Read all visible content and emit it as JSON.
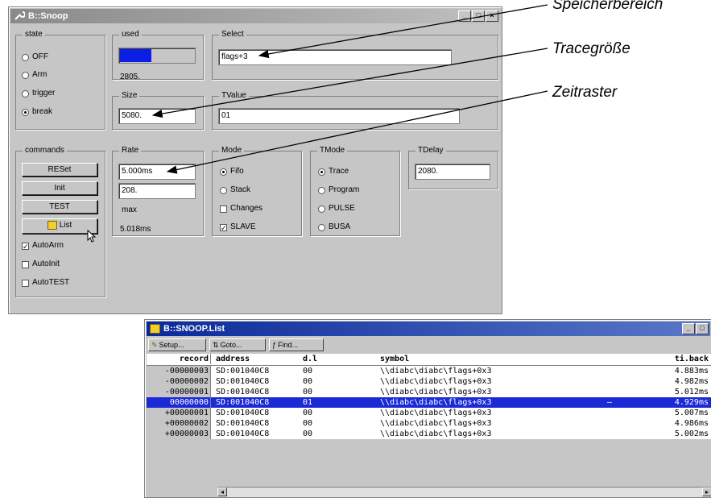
{
  "snoop_window": {
    "title": "B::Snoop",
    "title_buttons": [
      "_",
      "□",
      "×"
    ],
    "state": {
      "label": "state",
      "options": [
        {
          "label": "OFF",
          "selected": false
        },
        {
          "label": "Arm",
          "selected": false
        },
        {
          "label": "trigger",
          "selected": false
        },
        {
          "label": "break",
          "selected": true
        }
      ]
    },
    "used": {
      "label": "used",
      "fill_fraction": 0.42,
      "value": "2805."
    },
    "size": {
      "label": "Size",
      "value": "5080."
    },
    "select": {
      "label": "Select",
      "value": "flags+3"
    },
    "tvalue": {
      "label": "TValue",
      "value": "01"
    },
    "commands": {
      "label": "commands",
      "buttons": [
        "RESet",
        "Init",
        "TEST",
        "List"
      ],
      "checks": [
        {
          "label": "AutoArm",
          "checked": true
        },
        {
          "label": "AutoInit",
          "checked": false
        },
        {
          "label": "AutoTEST",
          "checked": false
        }
      ]
    },
    "rate": {
      "label": "Rate",
      "value": "5.000ms",
      "value2": "208.",
      "max_label": "max",
      "max_value": "5.018ms"
    },
    "mode": {
      "label": "Mode",
      "options": [
        {
          "label": "Fifo",
          "kind": "radio",
          "selected": true
        },
        {
          "label": "Stack",
          "kind": "radio",
          "selected": false
        },
        {
          "label": "Changes",
          "kind": "check",
          "selected": false
        },
        {
          "label": "SLAVE",
          "kind": "check",
          "selected": true
        }
      ]
    },
    "tmode": {
      "label": "TMode",
      "options": [
        {
          "label": "Trace",
          "selected": true
        },
        {
          "label": "Program",
          "selected": false
        },
        {
          "label": "PULSE",
          "selected": false
        },
        {
          "label": "BUSA",
          "selected": false
        }
      ]
    },
    "tdelay": {
      "label": "TDelay",
      "value": "2080."
    }
  },
  "callouts": {
    "speicher": "Speicherbereich",
    "trace": "Tracegröße",
    "zeit": "Zeitraster"
  },
  "list_window": {
    "title": "B::SNOOP.List",
    "toolbar": [
      {
        "label": "Setup...",
        "icon": "wrench-icon"
      },
      {
        "label": "Goto...",
        "icon": "goto-icon"
      },
      {
        "label": "Find...",
        "icon": "find-icon"
      }
    ],
    "headers": {
      "record": "record",
      "address": "address",
      "dl": "d.l",
      "symbol": "symbol",
      "tiback": "ti.back"
    },
    "rows": [
      {
        "record": "-00000003",
        "address": "SD:001040C8",
        "dl": "00",
        "symbol": "\\\\diabc\\diabc\\flags+0x3",
        "flag": "",
        "tiback": "4.883ms",
        "selected": false
      },
      {
        "record": "-00000002",
        "address": "SD:001040C8",
        "dl": "00",
        "symbol": "\\\\diabc\\diabc\\flags+0x3",
        "flag": "",
        "tiback": "4.982ms",
        "selected": false
      },
      {
        "record": "-00000001",
        "address": "SD:001040C8",
        "dl": "00",
        "symbol": "\\\\diabc\\diabc\\flags+0x3",
        "flag": "",
        "tiback": "5.012ms",
        "selected": false
      },
      {
        "record": " 00000000",
        "address": "SD:001040C8",
        "dl": "01",
        "symbol": "\\\\diabc\\diabc\\flags+0x3",
        "flag": "—",
        "tiback": "4.929ms",
        "selected": true
      },
      {
        "record": "+00000001",
        "address": "SD:001040C8",
        "dl": "00",
        "symbol": "\\\\diabc\\diabc\\flags+0x3",
        "flag": "",
        "tiback": "5.007ms",
        "selected": false
      },
      {
        "record": "+00000002",
        "address": "SD:001040C8",
        "dl": "00",
        "symbol": "\\\\diabc\\diabc\\flags+0x3",
        "flag": "",
        "tiback": "4.986ms",
        "selected": false
      },
      {
        "record": "+00000003",
        "address": "SD:001040C8",
        "dl": "00",
        "symbol": "\\\\diabc\\diabc\\flags+0x3",
        "flag": "",
        "tiback": "5.002ms",
        "selected": false
      }
    ]
  }
}
